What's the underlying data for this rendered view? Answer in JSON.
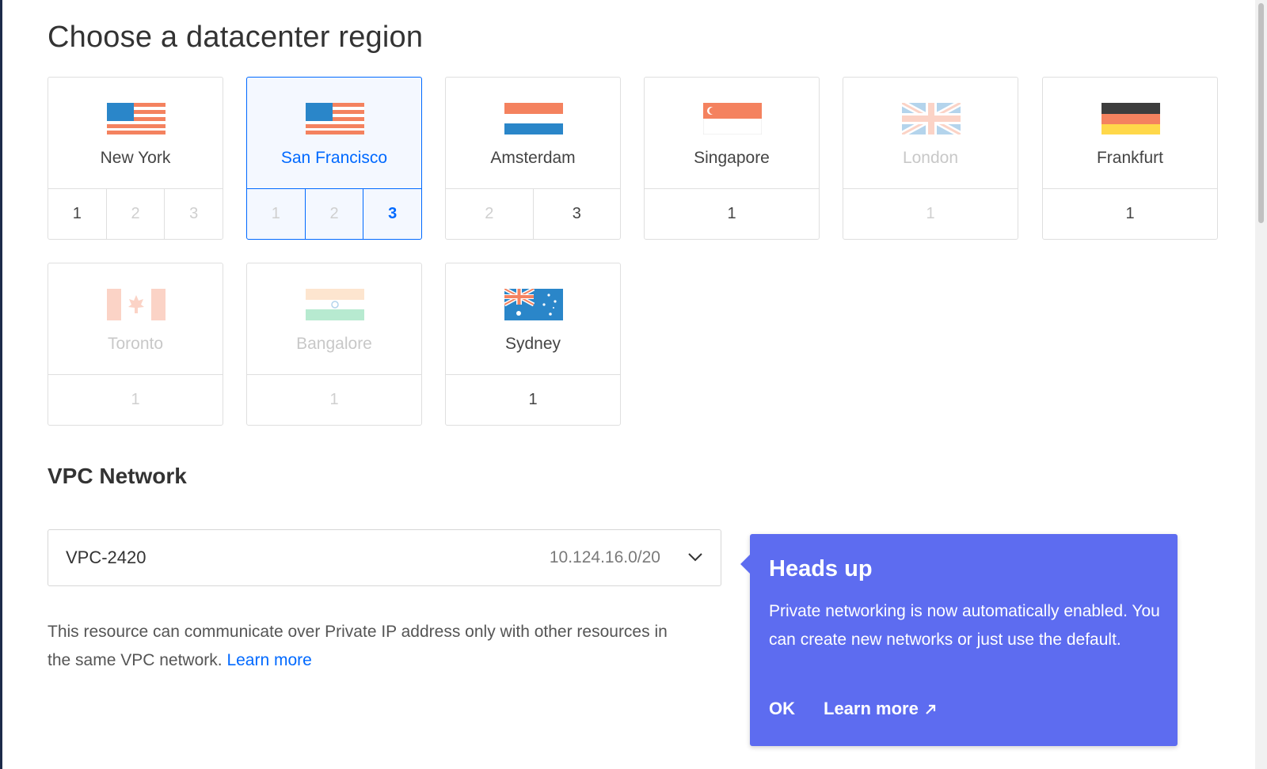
{
  "page": {
    "title": "Choose a datacenter region"
  },
  "regions": [
    {
      "city": "New York",
      "flag": "us-flag",
      "state": "normal",
      "dcs": [
        {
          "label": "1",
          "state": "on"
        },
        {
          "label": "2",
          "state": "off"
        },
        {
          "label": "3",
          "state": "off"
        }
      ]
    },
    {
      "city": "San Francisco",
      "flag": "us-flag",
      "state": "selected",
      "dcs": [
        {
          "label": "1",
          "state": "off"
        },
        {
          "label": "2",
          "state": "off"
        },
        {
          "label": "3",
          "state": "active"
        }
      ]
    },
    {
      "city": "Amsterdam",
      "flag": "nl-flag",
      "state": "normal",
      "dcs": [
        {
          "label": "2",
          "state": "off"
        },
        {
          "label": "3",
          "state": "on"
        }
      ]
    },
    {
      "city": "Singapore",
      "flag": "sg-flag",
      "state": "normal",
      "dcs": [
        {
          "label": "1",
          "state": "on"
        }
      ]
    },
    {
      "city": "London",
      "flag": "uk-flag",
      "state": "disabled",
      "dcs": [
        {
          "label": "1",
          "state": "off"
        }
      ]
    },
    {
      "city": "Frankfurt",
      "flag": "de-flag",
      "state": "normal",
      "dcs": [
        {
          "label": "1",
          "state": "on"
        }
      ]
    },
    {
      "city": "Toronto",
      "flag": "ca-flag",
      "state": "disabled",
      "dcs": [
        {
          "label": "1",
          "state": "off"
        }
      ]
    },
    {
      "city": "Bangalore",
      "flag": "in-flag",
      "state": "disabled",
      "dcs": [
        {
          "label": "1",
          "state": "off"
        }
      ]
    },
    {
      "city": "Sydney",
      "flag": "au-flag",
      "state": "normal",
      "dcs": [
        {
          "label": "1",
          "state": "on"
        }
      ]
    }
  ],
  "vpc": {
    "heading": "VPC Network",
    "selected_name": "VPC-2420",
    "selected_cidr": "10.124.16.0/20",
    "description": "This resource can communicate over Private IP address only with other resources in the same VPC network.",
    "learn_more": "Learn more"
  },
  "popover": {
    "title": "Heads up",
    "body": "Private networking is now automatically enabled. You can create new networks or just use the default.",
    "ok": "OK",
    "learn_more": "Learn more"
  },
  "colors": {
    "accent": "#0069ff",
    "popover_bg": "#5d6cf0",
    "border": "#dfdfdf"
  }
}
